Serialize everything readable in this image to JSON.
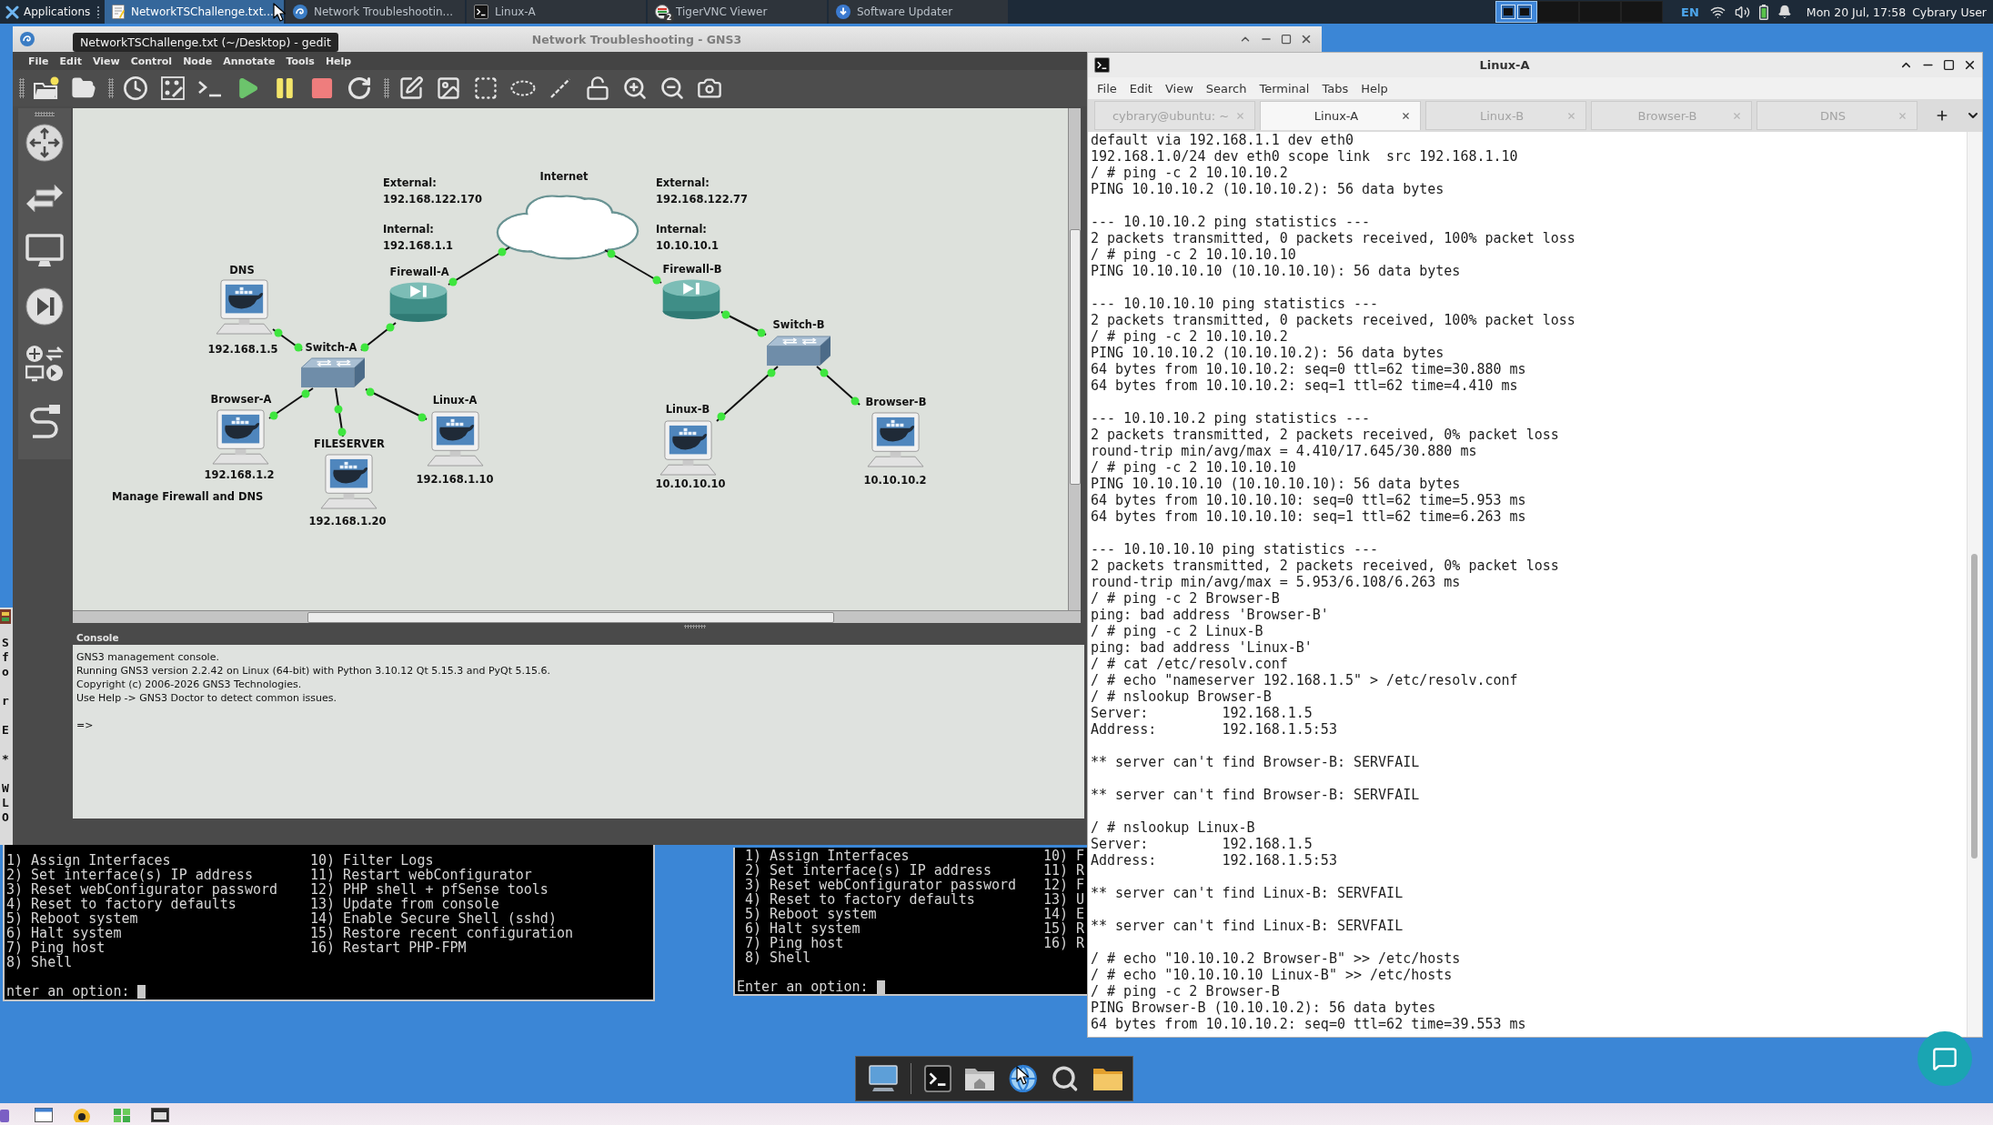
{
  "top_panel": {
    "menu_label": "Applications",
    "tasks": [
      {
        "kind": "editor",
        "label": "NetworkTSChallenge.txt...",
        "selected": true
      },
      {
        "kind": "gns3",
        "label": "Network Troubleshootin...",
        "selected": false
      },
      {
        "kind": "terminal",
        "label": "Linux-A",
        "selected": false
      },
      {
        "kind": "vnc",
        "label": "TigerVNC Viewer",
        "selected": false,
        "badge": "2"
      },
      {
        "kind": "updater",
        "label": "Software Updater",
        "selected": false
      }
    ],
    "workspaces": [
      {
        "selected": true
      },
      {
        "selected": false
      },
      {
        "selected": false
      },
      {
        "selected": false
      }
    ],
    "keyboard_layout": "EN",
    "clock": "Mon 20 Jul, 17:58",
    "user": "Cybrary User"
  },
  "tooltip": {
    "text": "NetworkTSChallenge.txt (~/Desktop) - gedit"
  },
  "gns3": {
    "title": "Network Troubleshooting - GNS3",
    "menu": [
      "File",
      "Edit",
      "View",
      "Control",
      "Node",
      "Annotate",
      "Tools",
      "Help"
    ],
    "canvas": {
      "nodes": [
        {
          "kind": "cloud",
          "label": "Internet"
        },
        {
          "kind": "host",
          "label": "DNS",
          "address": "192.168.1.5"
        },
        {
          "kind": "firewall",
          "label": "Firewall-A"
        },
        {
          "kind": "firewall",
          "label": "Firewall-B"
        },
        {
          "kind": "switch",
          "label": "Switch-A"
        },
        {
          "kind": "switch",
          "label": "Switch-B"
        },
        {
          "kind": "host",
          "label": "Browser-A",
          "address": "192.168.1.2"
        },
        {
          "kind": "host",
          "label": "FILESERVER",
          "address": "192.168.1.20"
        },
        {
          "kind": "host",
          "label": "Linux-A",
          "address": "192.168.1.10"
        },
        {
          "kind": "host",
          "label": "Linux-B",
          "address": "10.10.10.10"
        },
        {
          "kind": "host",
          "label": "Browser-B",
          "address": "10.10.10.2"
        }
      ],
      "annotations": [
        {
          "lines": [
            "External:",
            "192.168.122.170"
          ]
        },
        {
          "lines": [
            "External:",
            "192.168.122.77"
          ]
        },
        {
          "lines": [
            "Internal:",
            "192.168.1.1"
          ]
        },
        {
          "lines": [
            "Internal:",
            "10.10.10.1"
          ]
        },
        {
          "lines": [
            "Manage Firewall and DNS"
          ]
        }
      ],
      "links": [
        {
          "up": true
        },
        {
          "up": true
        },
        {
          "up": true
        },
        {
          "up": true
        },
        {
          "up": true
        },
        {
          "up": true
        },
        {
          "up": true
        },
        {
          "up": true
        },
        {
          "up": true
        },
        {
          "up": true
        }
      ]
    },
    "console": {
      "title": "Console",
      "lines": [
        "GNS3 management console.",
        "Running GNS3 version 2.2.42 on Linux (64-bit) with Python 3.10.12 Qt 5.15.3 and PyQt 5.15.6.",
        "Copyright (c) 2006-2026 GNS3 Technologies.",
        "Use Help -> GNS3 Doctor to detect common issues."
      ],
      "prompt": "=>"
    }
  },
  "edge_window": {
    "blocks": [
      [
        "S",
        "f",
        "o"
      ],
      [
        "r"
      ],
      [
        "E"
      ],
      [
        "*"
      ],
      [
        "W",
        "L",
        "O"
      ]
    ]
  },
  "pfsense_consoles": [
    {
      "options_left": [
        "1) Assign Interfaces",
        "2) Set interface(s) IP address",
        "3) Reset webConfigurator password",
        "4) Reset to factory defaults",
        "5) Reboot system",
        "6) Halt system",
        "7) Ping host",
        "8) Shell"
      ],
      "options_right": [
        "10) Filter Logs",
        "11) Restart webConfigurator",
        "12) PHP shell + pfSense tools",
        "13) Update from console",
        "14) Enable Secure Shell (sshd)",
        "15) Restore recent configuration",
        "16) Restart PHP-FPM"
      ],
      "prompt": "nter an option:"
    },
    {
      "options_left": [
        "1) Assign Interfaces",
        "2) Set interface(s) IP address",
        "3) Reset webConfigurator password",
        "4) Reset to factory defaults",
        "5) Reboot system",
        "6) Halt system",
        "7) Ping host",
        "8) Shell"
      ],
      "options_right": [
        "10) F",
        "11) R",
        "12) F",
        "13) U",
        "14) E",
        "15) R",
        "16) R"
      ],
      "prompt": "Enter an option:"
    }
  ],
  "terminal": {
    "title": "Linux-A",
    "menu": [
      "File",
      "Edit",
      "View",
      "Search",
      "Terminal",
      "Tabs",
      "Help"
    ],
    "tabs": [
      {
        "label": "cybrary@ubuntu: ~",
        "selected": false
      },
      {
        "label": "Linux-A",
        "selected": true
      },
      {
        "label": "Linux-B",
        "selected": false
      },
      {
        "label": "Browser-B",
        "selected": false
      },
      {
        "label": "DNS",
        "selected": false
      }
    ],
    "blocks": [
      [
        "default via 192.168.1.1 dev eth0",
        "192.168.1.0/24 dev eth0 scope link  src 192.168.1.10",
        "/ # ping -c 2 10.10.10.2",
        "PING 10.10.10.2 (10.10.10.2): 56 data bytes"
      ],
      [
        "--- 10.10.10.2 ping statistics ---",
        "2 packets transmitted, 0 packets received, 100% packet loss",
        "/ # ping -c 2 10.10.10.10",
        "PING 10.10.10.10 (10.10.10.10): 56 data bytes"
      ],
      [
        "--- 10.10.10.10 ping statistics ---",
        "2 packets transmitted, 0 packets received, 100% packet loss",
        "/ # ping -c 2 10.10.10.2",
        "PING 10.10.10.2 (10.10.10.2): 56 data bytes",
        "64 bytes from 10.10.10.2: seq=0 ttl=62 time=30.880 ms",
        "64 bytes from 10.10.10.2: seq=1 ttl=62 time=4.410 ms"
      ],
      [
        "--- 10.10.10.2 ping statistics ---",
        "2 packets transmitted, 2 packets received, 0% packet loss",
        "round-trip min/avg/max = 4.410/17.645/30.880 ms",
        "/ # ping -c 2 10.10.10.10",
        "PING 10.10.10.10 (10.10.10.10): 56 data bytes",
        "64 bytes from 10.10.10.10: seq=0 ttl=62 time=5.953 ms",
        "64 bytes from 10.10.10.10: seq=1 ttl=62 time=6.263 ms"
      ],
      [
        "--- 10.10.10.10 ping statistics ---",
        "2 packets transmitted, 2 packets received, 0% packet loss",
        "round-trip min/avg/max = 5.953/6.108/6.263 ms",
        "/ # ping -c 2 Browser-B",
        "ping: bad address 'Browser-B'",
        "/ # ping -c 2 Linux-B",
        "ping: bad address 'Linux-B'",
        "/ # cat /etc/resolv.conf",
        "/ # echo \"nameserver 192.168.1.5\" > /etc/resolv.conf",
        "/ # nslookup Browser-B",
        "Server:         192.168.1.5",
        "Address:        192.168.1.5:53"
      ],
      [
        "** server can't find Browser-B: SERVFAIL"
      ],
      [
        "** server can't find Browser-B: SERVFAIL"
      ],
      [
        "/ # nslookup Linux-B",
        "Server:         192.168.1.5",
        "Address:        192.168.1.5:53"
      ],
      [
        "** server can't find Linux-B: SERVFAIL"
      ],
      [
        "** server can't find Linux-B: SERVFAIL"
      ],
      [
        "/ # echo \"10.10.10.2 Browser-B\" >> /etc/hosts",
        "/ # echo \"10.10.10.10 Linux-B\" >> /etc/hosts",
        "/ # ping -c 2 Browser-B",
        "PING Browser-B (10.10.10.2): 56 data bytes",
        "64 bytes from 10.10.10.2: seq=0 ttl=62 time=39.553 ms"
      ]
    ]
  }
}
